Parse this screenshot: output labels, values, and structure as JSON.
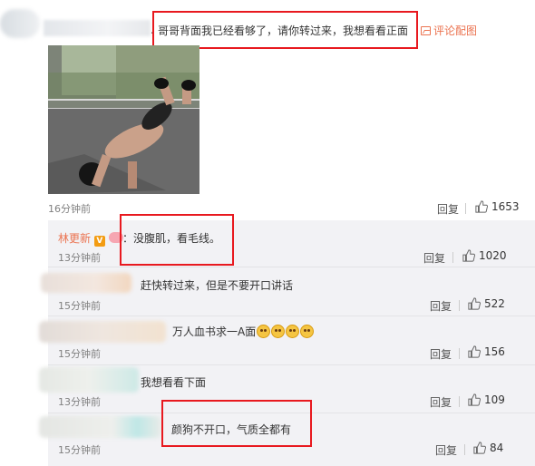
{
  "main_comment": {
    "text": "哥哥背面我已经看够了，请你转过来，我想看看正面",
    "pic_link": "评论配图",
    "time": "16分钟前",
    "reply_label": "回复",
    "likes": "1653",
    "separator": "."
  },
  "replies": [
    {
      "user": "林更新",
      "badge": "V",
      "text": "：没腹肌，看毛线。",
      "time": "13分钟前",
      "reply_label": "回复",
      "likes": "1020"
    },
    {
      "user": "",
      "text": "赶快转过来，但是不要开口讲话",
      "time": "15分钟前",
      "reply_label": "回复",
      "likes": "522"
    },
    {
      "user": "",
      "text": "万人血书求一A面",
      "time": "15分钟前",
      "reply_label": "回复",
      "likes": "156",
      "emoji_count": 4
    },
    {
      "user": "",
      "text": "我想看看下面",
      "time": "13分钟前",
      "reply_label": "回复",
      "likes": "109"
    },
    {
      "user": "",
      "text": "颜狗不开口，气质全都有",
      "time": "15分钟前",
      "reply_label": "回复",
      "likes": "84"
    }
  ],
  "colors": {
    "accent": "#eb7350",
    "highlight_box": "#e8191f",
    "reply_bg": "#f2f2f5"
  }
}
